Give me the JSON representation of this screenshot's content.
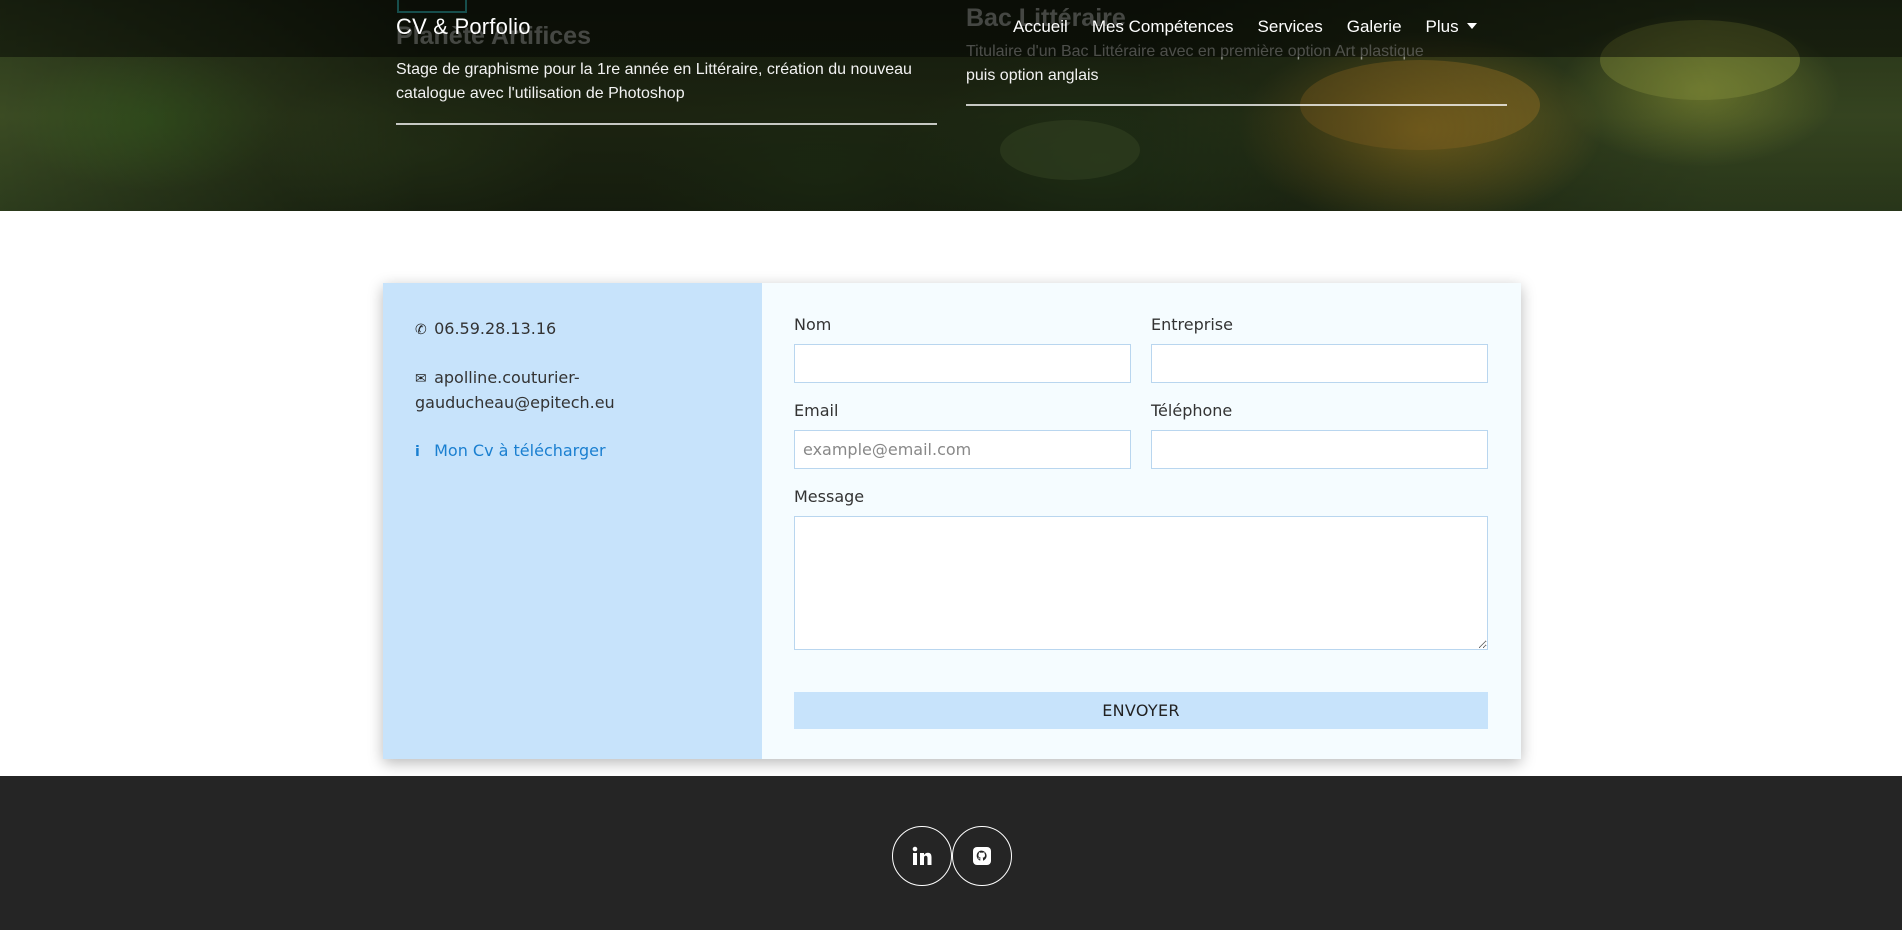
{
  "navbar": {
    "brand": "CV & Porfolio",
    "links": [
      "Accueil",
      "Mes Compétences",
      "Services",
      "Galerie",
      "Plus"
    ]
  },
  "timeline": [
    {
      "title": "Planète Artifices",
      "text": "Stage de graphisme pour la 1re année en Littéraire, création du nouveau catalogue avec l'utilisation de Photoshop"
    },
    {
      "title": "Bac Littéraire",
      "text_line1": "Titulaire d'un Bac Littéraire avec en première option Art plastique",
      "text_line2": "puis option anglais"
    }
  ],
  "contact": {
    "phone": "06.59.28.13.16",
    "email_line1": "apolline.couturier-",
    "email_line2": "gauducheau@epitech.eu",
    "cv_link": "Mon Cv à télécharger"
  },
  "form": {
    "nom_label": "Nom",
    "entreprise_label": "Entreprise",
    "email_label": "Email",
    "email_placeholder": "example@email.com",
    "telephone_label": "Téléphone",
    "message_label": "Message",
    "submit_label": "ENVOYER"
  },
  "footer": {
    "socials": [
      "linkedin-icon",
      "github-icon"
    ]
  },
  "colors": {
    "panel_blue": "#c7e3fb",
    "form_bg": "#f5fcff",
    "link_blue": "#1a7fd0",
    "footer_bg": "#252525"
  }
}
